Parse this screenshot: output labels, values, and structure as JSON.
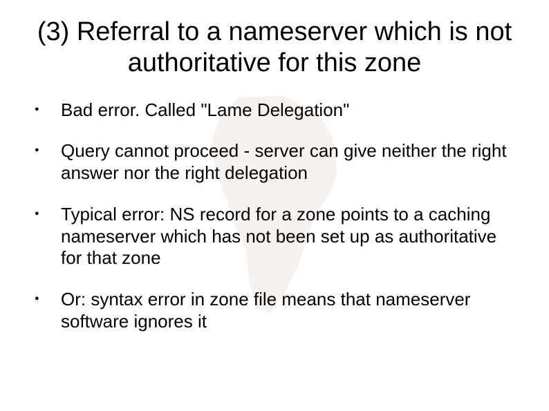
{
  "title": "(3) Referral to a nameserver which is not authoritative for this zone",
  "bullets": [
    "Bad error. Called \"Lame Delegation\"",
    "Query cannot proceed - server can give neither the right answer nor the right delegation",
    "Typical error: NS record for a zone points to a caching nameserver which has not been set up as authoritative for that zone",
    "Or: syntax error in zone file means that nameserver software ignores it"
  ]
}
